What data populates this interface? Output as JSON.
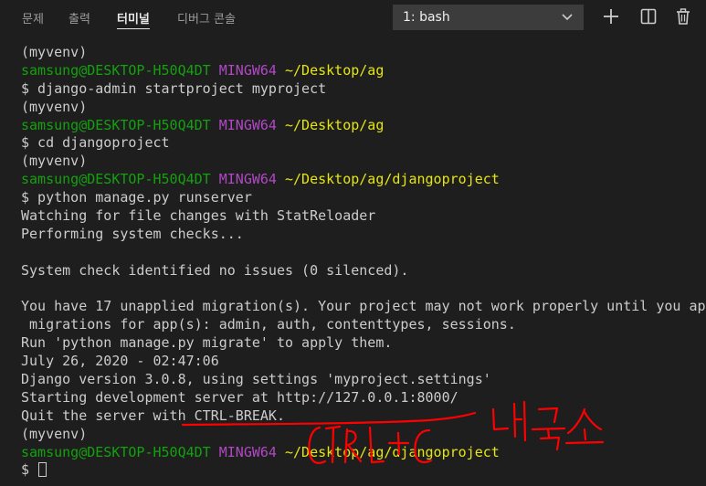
{
  "panel": {
    "tabs": [
      {
        "label": "문제"
      },
      {
        "label": "출력"
      },
      {
        "label": "터미널"
      },
      {
        "label": "디버그 콘솔"
      }
    ],
    "terminal_select": {
      "value": "1: bash"
    }
  },
  "icons": {
    "add": "plus-icon",
    "split": "split-icon",
    "delete": "trash-icon"
  },
  "colors": {
    "background": "#1e1e1e",
    "text": "#cccccc",
    "prompt_user": "#13a10e",
    "prompt_env": "#b148c6",
    "prompt_path": "#e5e510",
    "annotation": "#ff0000"
  },
  "terminal": {
    "lines": [
      {
        "text": "(myvenv)"
      },
      {
        "user": "samsung@DESKTOP-H50Q4DT",
        "env": "MINGW64",
        "path": "~/Desktop/ag"
      },
      {
        "text": "$ django-admin startproject myproject"
      },
      {
        "text": "(myvenv)"
      },
      {
        "user": "samsung@DESKTOP-H50Q4DT",
        "env": "MINGW64",
        "path": "~/Desktop/ag"
      },
      {
        "text": "$ cd djangoproject"
      },
      {
        "text": "(myvenv)"
      },
      {
        "user": "samsung@DESKTOP-H50Q4DT",
        "env": "MINGW64",
        "path": "~/Desktop/ag/djangoproject"
      },
      {
        "text": "$ python manage.py runserver"
      },
      {
        "text": "Watching for file changes with StatReloader"
      },
      {
        "text": "Performing system checks..."
      },
      {
        "text": ""
      },
      {
        "text": "System check identified no issues (0 silenced)."
      },
      {
        "text": ""
      },
      {
        "text": "You have 17 unapplied migration(s). Your project may not work properly until you app"
      },
      {
        "text": " migrations for app(s): admin, auth, contenttypes, sessions."
      },
      {
        "text": "Run 'python manage.py migrate' to apply them."
      },
      {
        "text": "July 26, 2020 - 02:47:06"
      },
      {
        "text": "Django version 3.0.8, using settings 'myproject.settings'"
      },
      {
        "text": "Starting development server at http://127.0.0.1:8000/"
      },
      {
        "text": "Quit the server with CTRL-BREAK."
      },
      {
        "text": "(myvenv)"
      },
      {
        "user": "samsung@DESKTOP-H50Q4DT",
        "env": "MINGW64",
        "path": "~/Desktop/ag/djangoproject"
      },
      {
        "text": "$ "
      }
    ]
  },
  "annotation": {
    "handwriting": [
      "CTRL+C",
      "내국소"
    ]
  }
}
